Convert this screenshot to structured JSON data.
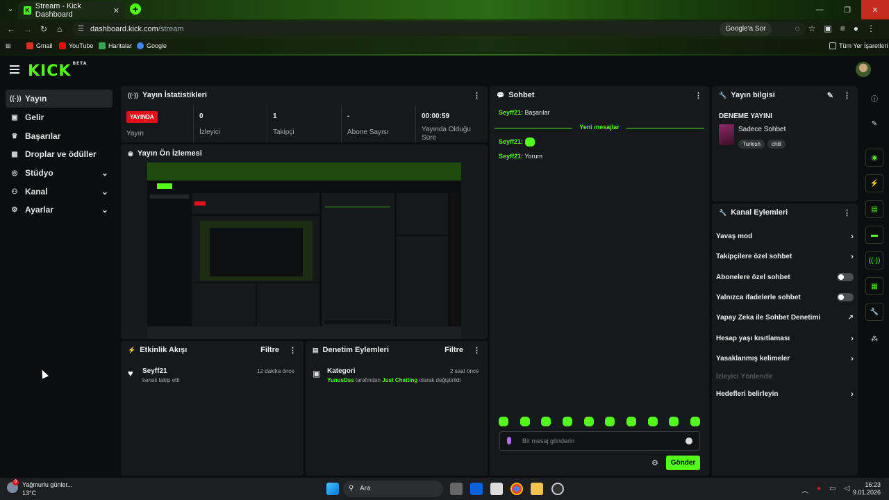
{
  "browser": {
    "tab_title": "Stream - Kick Dashboard",
    "url_host": "dashboard.kick.com",
    "url_path": "/stream",
    "ask_google": "Google'a Sor",
    "bookmarks": [
      "Gmail",
      "YouTube",
      "Haritalar",
      "Google"
    ],
    "all_bookmarks": "Tüm Yer İşaretleri"
  },
  "kick": {
    "logo": "KICK",
    "logo_badge": "BETA"
  },
  "sidebar": {
    "items": [
      {
        "label": "Yayın",
        "icon": "broadcast-icon"
      },
      {
        "label": "Gelir",
        "icon": "income-icon"
      },
      {
        "label": "Başarılar",
        "icon": "trophy-icon"
      },
      {
        "label": "Droplar ve ödüller",
        "icon": "drops-icon"
      },
      {
        "label": "Stüdyo",
        "icon": "studio-icon"
      },
      {
        "label": "Kanal",
        "icon": "channel-icon"
      },
      {
        "label": "Ayarlar",
        "icon": "settings-icon"
      }
    ]
  },
  "stats": {
    "title": "Yayın İstatistikleri",
    "live_badge": "YAYINDA",
    "items": [
      {
        "value": "",
        "label": "Yayın"
      },
      {
        "value": "0",
        "label": "İzleyici"
      },
      {
        "value": "1",
        "label": "Takipçi"
      },
      {
        "value": "-",
        "label": "Abone Sayısı"
      },
      {
        "value": "00:00:59",
        "label": "Yayında Olduğu Süre"
      }
    ]
  },
  "preview": {
    "title": "Yayın Ön İzlemesi"
  },
  "activity": {
    "title": "Etkinlik Akışı",
    "filter": "Filtre",
    "events": [
      {
        "name": "Seyff21",
        "text": "kanalı takip etti",
        "time": "12 dakika önce"
      }
    ]
  },
  "moderation": {
    "title": "Denetim Eylemleri",
    "filter": "Filtre",
    "events": [
      {
        "name": "Kategori",
        "user": "YunusDss",
        "mid": "tarafından",
        "category": "Just Chatting",
        "tail": "olarak değiştirildi",
        "time": "2 saat önce"
      }
    ]
  },
  "chat": {
    "title": "Sohbet",
    "messages": [
      {
        "user": "Seyff21:",
        "text": "Başarılar"
      },
      {
        "user": "Seyff21:",
        "text": ""
      },
      {
        "user": "Seyff21:",
        "text": "Yorum"
      }
    ],
    "new_messages": "Yeni mesajlar",
    "placeholder": "Bir mesaj gönderin",
    "send": "Gönder"
  },
  "stream_info": {
    "title": "Yayın bilgisi",
    "stream_title": "DENEME YAYINI",
    "category": "Sadece Sohbet",
    "tags": [
      "Turkish",
      "chill"
    ]
  },
  "channel_actions": {
    "title": "Kanal Eylemleri",
    "items": [
      {
        "label": "Yavaş mod",
        "control": "chevron"
      },
      {
        "label": "Takipçilere özel sohbet",
        "control": "chevron"
      },
      {
        "label": "Abonelere özel sohbet",
        "control": "toggle"
      },
      {
        "label": "Yalnızca ifadelerle sohbet",
        "control": "toggle"
      },
      {
        "label": "Yapay Zeka ile Sohbet Denetimi",
        "control": "external"
      },
      {
        "label": "Hesap yaşı kısıtlaması",
        "control": "chevron"
      },
      {
        "label": "Yasaklanmış kelimeler",
        "control": "chevron"
      },
      {
        "label": "İzleyici Yönlendir",
        "control": "disabled"
      },
      {
        "label": "Hedefleri belirleyin",
        "control": "chevron"
      }
    ]
  },
  "taskbar": {
    "weather_text": "Yağmurlu günler...",
    "temperature": "13°C",
    "notification_count": "8",
    "search": "Ara",
    "time": "16:23",
    "date": "9.01.2026"
  },
  "colors": {
    "accent": "#53fc18",
    "live": "#e3101b",
    "panel": "#16191b",
    "bg": "#0b0e0f"
  }
}
